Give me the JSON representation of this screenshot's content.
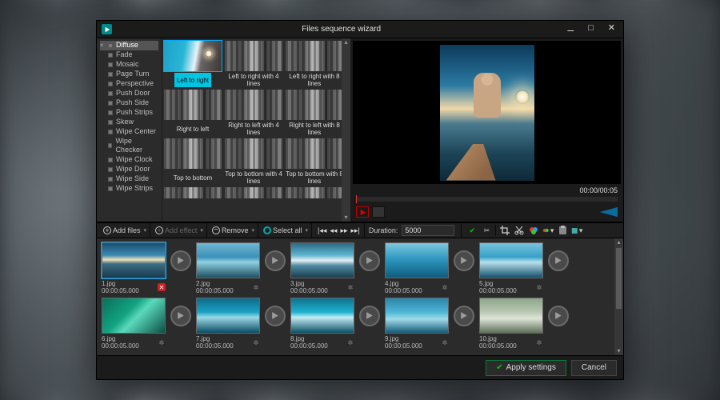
{
  "window": {
    "title": "Files sequence wizard"
  },
  "tree": [
    {
      "label": "Diffuse",
      "expanded": true,
      "selected": true
    },
    {
      "label": "Fade"
    },
    {
      "label": "Mosaic"
    },
    {
      "label": "Page Turn"
    },
    {
      "label": "Perspective"
    },
    {
      "label": "Push Door"
    },
    {
      "label": "Push Side"
    },
    {
      "label": "Push Strips"
    },
    {
      "label": "Skew"
    },
    {
      "label": "Wipe Center"
    },
    {
      "label": "Wipe Checker"
    },
    {
      "label": "Wipe Clock"
    },
    {
      "label": "Wipe Door"
    },
    {
      "label": "Wipe Side"
    },
    {
      "label": "Wipe Strips"
    }
  ],
  "transitions": [
    {
      "label": "Left to right",
      "selected": true
    },
    {
      "label": "Left to right with 4 lines"
    },
    {
      "label": "Left to right with 8 lines"
    },
    {
      "label": "Right to left"
    },
    {
      "label": "Right to left with 4 lines"
    },
    {
      "label": "Right to left with 8 lines"
    },
    {
      "label": "Top to bottom"
    },
    {
      "label": "Top to bottom with 4 lines"
    },
    {
      "label": "Top to bottom with 8 lines"
    }
  ],
  "preview": {
    "time": "00:00/00:05"
  },
  "toolbar": {
    "add_files": "Add files",
    "add_effect": "Add effect",
    "remove": "Remove",
    "select_all": "Select all",
    "duration_label": "Duration:",
    "duration_value": "5000"
  },
  "clips": [
    {
      "name": "1.jpg",
      "duration": "00:00:05.000",
      "selected": true,
      "deletable": true,
      "th": "t1"
    },
    {
      "name": "2.jpg",
      "duration": "00:00:05.000",
      "th": "t2"
    },
    {
      "name": "3.jpg",
      "duration": "00:00:05.000",
      "th": "t3"
    },
    {
      "name": "4.jpg",
      "duration": "00:00:05.000",
      "th": "t4"
    },
    {
      "name": "5.jpg",
      "duration": "00:00:05.000",
      "th": "t5"
    },
    {
      "name": "6.jpg",
      "duration": "00:00:05.000",
      "th": "t6"
    },
    {
      "name": "7.jpg",
      "duration": "00:00:05.000",
      "th": "t7"
    },
    {
      "name": "8.jpg",
      "duration": "00:00:05.000",
      "th": "t8"
    },
    {
      "name": "9.jpg",
      "duration": "00:00:05.000",
      "th": "t9"
    },
    {
      "name": "10.jpg",
      "duration": "00:00:05.000",
      "th": "t10"
    }
  ],
  "footer": {
    "apply": "Apply settings",
    "cancel": "Cancel"
  }
}
